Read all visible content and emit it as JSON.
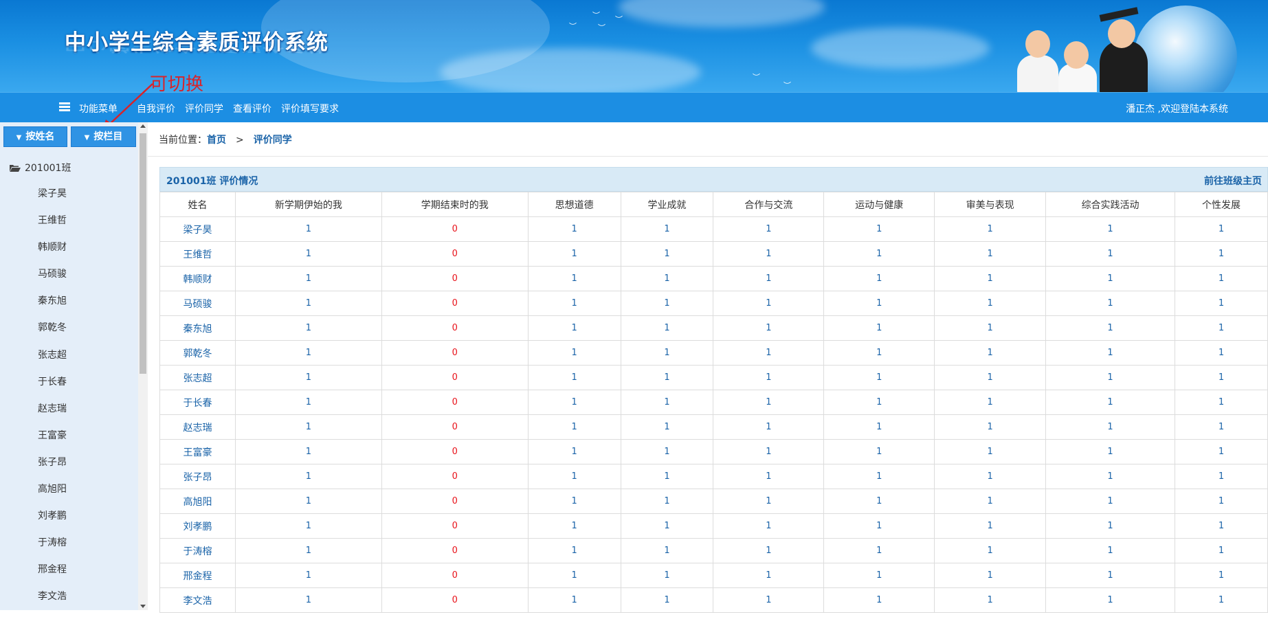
{
  "app": {
    "title": "中小学生综合素质评价系统"
  },
  "nav": {
    "menu_label": "功能菜单",
    "links": [
      "自我评价",
      "评价同学",
      "查看评价",
      "评价填写要求"
    ],
    "welcome": "潘正杰 ,欢迎登陆本系统"
  },
  "annotation": {
    "text": "可切换"
  },
  "sidebar": {
    "buttons": [
      "按姓名",
      "按栏目"
    ],
    "class_node": "201001班",
    "students": [
      "梁子昊",
      "王维哲",
      "韩顺财",
      "马硕骏",
      "秦东旭",
      "郭乾冬",
      "张志超",
      "于长春",
      "赵志瑞",
      "王富豪",
      "张子昂",
      "高旭阳",
      "刘孝鹏",
      "于涛榕",
      "邢金程",
      "李文浩"
    ]
  },
  "breadcrumb": {
    "prefix": "当前位置：",
    "home": "首页",
    "separator": ">",
    "current": "评价同学"
  },
  "panel": {
    "title": "201001班 评价情况",
    "link": "前往班级主页"
  },
  "table": {
    "headers": [
      "姓名",
      "新学期伊始的我",
      "学期结束时的我",
      "思想道德",
      "学业成就",
      "合作与交流",
      "运动与健康",
      "审美与表现",
      "综合实践活动",
      "个性发展"
    ],
    "rows": [
      {
        "name": "梁子昊",
        "values": [
          "1",
          "0",
          "1",
          "1",
          "1",
          "1",
          "1",
          "1",
          "1"
        ]
      },
      {
        "name": "王维哲",
        "values": [
          "1",
          "0",
          "1",
          "1",
          "1",
          "1",
          "1",
          "1",
          "1"
        ]
      },
      {
        "name": "韩顺财",
        "values": [
          "1",
          "0",
          "1",
          "1",
          "1",
          "1",
          "1",
          "1",
          "1"
        ]
      },
      {
        "name": "马硕骏",
        "values": [
          "1",
          "0",
          "1",
          "1",
          "1",
          "1",
          "1",
          "1",
          "1"
        ]
      },
      {
        "name": "秦东旭",
        "values": [
          "1",
          "0",
          "1",
          "1",
          "1",
          "1",
          "1",
          "1",
          "1"
        ]
      },
      {
        "name": "郭乾冬",
        "values": [
          "1",
          "0",
          "1",
          "1",
          "1",
          "1",
          "1",
          "1",
          "1"
        ]
      },
      {
        "name": "张志超",
        "values": [
          "1",
          "0",
          "1",
          "1",
          "1",
          "1",
          "1",
          "1",
          "1"
        ]
      },
      {
        "name": "于长春",
        "values": [
          "1",
          "0",
          "1",
          "1",
          "1",
          "1",
          "1",
          "1",
          "1"
        ]
      },
      {
        "name": "赵志瑞",
        "values": [
          "1",
          "0",
          "1",
          "1",
          "1",
          "1",
          "1",
          "1",
          "1"
        ]
      },
      {
        "name": "王富豪",
        "values": [
          "1",
          "0",
          "1",
          "1",
          "1",
          "1",
          "1",
          "1",
          "1"
        ]
      },
      {
        "name": "张子昂",
        "values": [
          "1",
          "0",
          "1",
          "1",
          "1",
          "1",
          "1",
          "1",
          "1"
        ]
      },
      {
        "name": "高旭阳",
        "values": [
          "1",
          "0",
          "1",
          "1",
          "1",
          "1",
          "1",
          "1",
          "1"
        ]
      },
      {
        "name": "刘孝鹏",
        "values": [
          "1",
          "0",
          "1",
          "1",
          "1",
          "1",
          "1",
          "1",
          "1"
        ]
      },
      {
        "name": "于涛榕",
        "values": [
          "1",
          "0",
          "1",
          "1",
          "1",
          "1",
          "1",
          "1",
          "1"
        ]
      },
      {
        "name": "邢金程",
        "values": [
          "1",
          "0",
          "1",
          "1",
          "1",
          "1",
          "1",
          "1",
          "1"
        ]
      },
      {
        "name": "李文浩",
        "values": [
          "1",
          "0",
          "1",
          "1",
          "1",
          "1",
          "1",
          "1",
          "1"
        ]
      }
    ]
  },
  "colors": {
    "nav_bg": "#1c8ee3",
    "link": "#1a63a8",
    "zero_value": "#e8121a",
    "sidebar_bg": "#e4eef9",
    "annotation": "#d8232a"
  }
}
